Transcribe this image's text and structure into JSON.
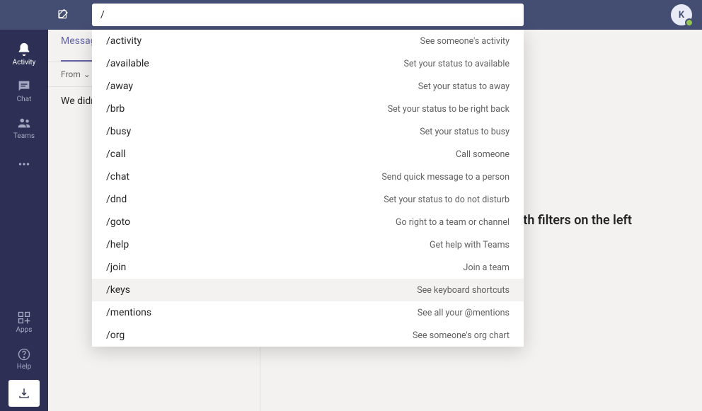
{
  "header": {
    "search_value": "/",
    "avatar_initial": "K"
  },
  "sidebar": {
    "items": [
      {
        "label": "Activity"
      },
      {
        "label": "Chat"
      },
      {
        "label": "Teams"
      }
    ],
    "bottom": [
      {
        "label": "Apps"
      },
      {
        "label": "Help"
      }
    ]
  },
  "left_panel": {
    "tabs": [
      {
        "label": "Messages",
        "active": true
      }
    ],
    "filter": {
      "label": "From",
      "chevron": "⌄"
    },
    "content": "We didn't find any matches."
  },
  "main": {
    "empty_text": "Find messages, files, and more with filters on the left"
  },
  "commands": [
    {
      "cmd": "/activity",
      "desc": "See someone's activity"
    },
    {
      "cmd": "/available",
      "desc": "Set your status to available"
    },
    {
      "cmd": "/away",
      "desc": "Set your status to away"
    },
    {
      "cmd": "/brb",
      "desc": "Set your status to be right back"
    },
    {
      "cmd": "/busy",
      "desc": "Set your status to busy"
    },
    {
      "cmd": "/call",
      "desc": "Call someone"
    },
    {
      "cmd": "/chat",
      "desc": "Send quick message to a person"
    },
    {
      "cmd": "/dnd",
      "desc": "Set your status to do not disturb"
    },
    {
      "cmd": "/goto",
      "desc": "Go right to a team or channel"
    },
    {
      "cmd": "/help",
      "desc": "Get help with Teams"
    },
    {
      "cmd": "/join",
      "desc": "Join a team"
    },
    {
      "cmd": "/keys",
      "desc": "See keyboard shortcuts",
      "highlighted": true
    },
    {
      "cmd": "/mentions",
      "desc": "See all your @mentions"
    },
    {
      "cmd": "/org",
      "desc": "See someone's org chart"
    }
  ]
}
